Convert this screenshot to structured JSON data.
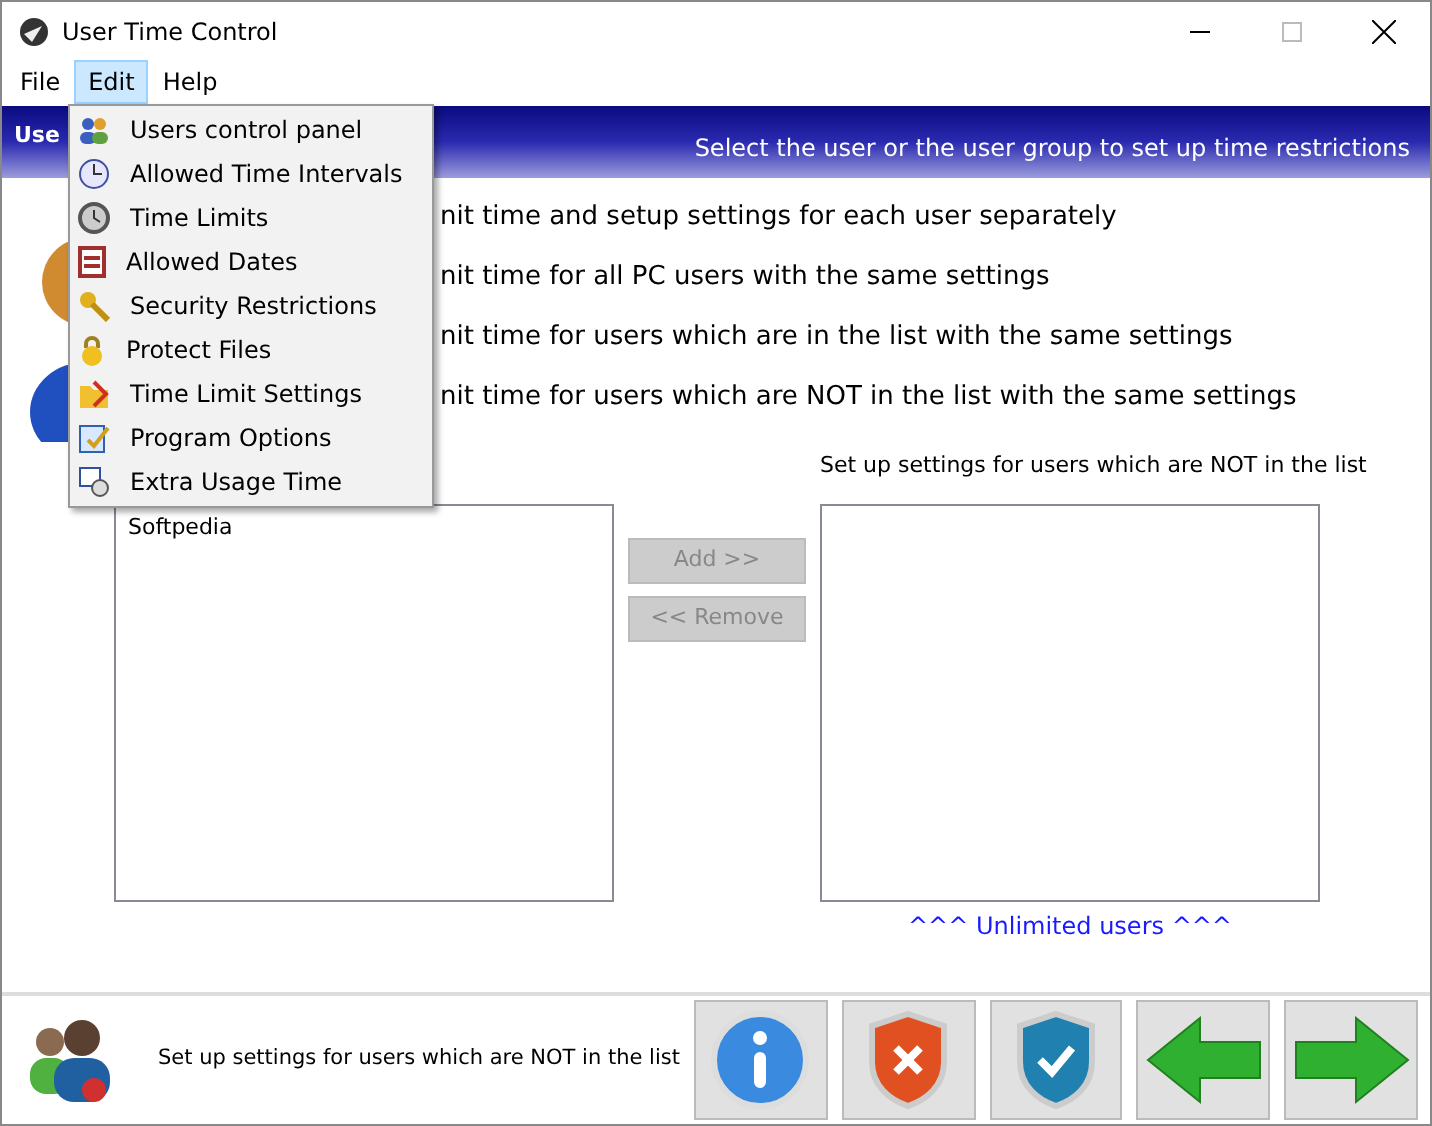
{
  "window": {
    "title": "User Time Control"
  },
  "menu_bar": [
    {
      "label": "File",
      "selected": false
    },
    {
      "label": "Edit",
      "selected": true
    },
    {
      "label": "Help",
      "selected": false
    }
  ],
  "edit_menu": [
    {
      "label": "Users control panel"
    },
    {
      "label": "Allowed Time Intervals"
    },
    {
      "label": "Time Limits"
    },
    {
      "label": "Allowed Dates"
    },
    {
      "label": "Security Restrictions"
    },
    {
      "label": "Protect Files"
    },
    {
      "label": "Time Limit Settings"
    },
    {
      "label": "Program Options"
    },
    {
      "label": "Extra Usage Time"
    }
  ],
  "header": {
    "title_partial": "Use",
    "subtitle": "Select the user or the user group to set up time restrictions"
  },
  "options": [
    "nit time and setup settings for each user separately",
    "nit time for all PC users with the same settings",
    "nit time for users which are in the list with the same settings",
    "nit time for users which are NOT in the list with the same settings"
  ],
  "right_list_label": "Set up settings for users which are NOT in the list",
  "left_list": [
    "Softpedia"
  ],
  "add_button": {
    "label": "Add >>",
    "disabled": true
  },
  "remove_button": {
    "label": "<< Remove",
    "disabled": true
  },
  "unlimited_link": "^^^ Unlimited users ^^^",
  "footer": {
    "text": "Set up settings for users which are NOT in the list"
  }
}
